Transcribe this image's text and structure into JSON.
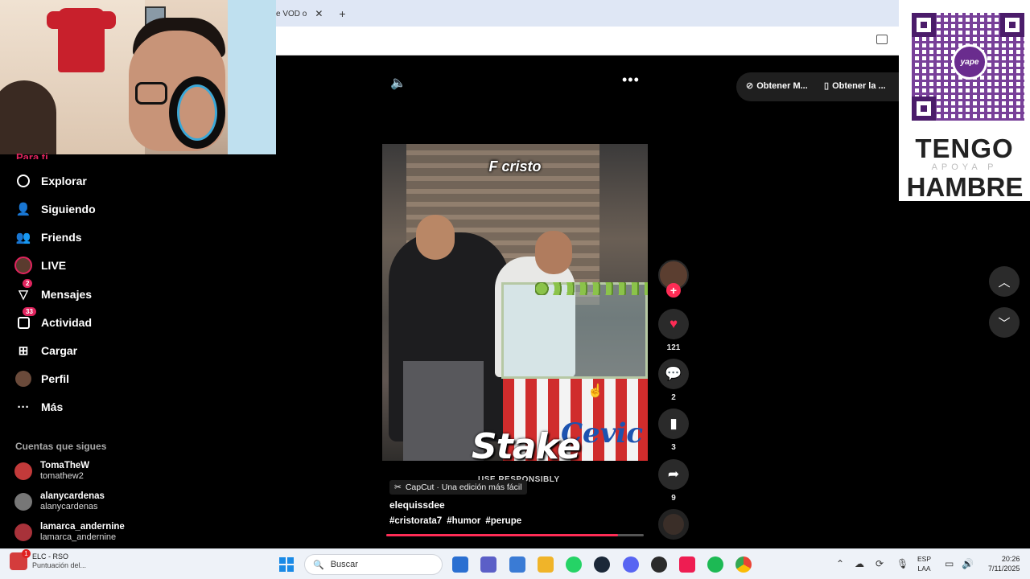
{
  "browser": {
    "tab_fragment": "e VOD o",
    "tab_close": "✕",
    "new_tab": "+"
  },
  "sidebar": {
    "cut_label": "Para ti",
    "items": [
      {
        "label": "Explorar",
        "icon": "compass-icon"
      },
      {
        "label": "Siguiendo",
        "icon": "person-follow-icon"
      },
      {
        "label": "Friends",
        "icon": "friends-icon"
      },
      {
        "label": "LIVE",
        "icon": "live-avatar-icon"
      },
      {
        "label": "Mensajes",
        "icon": "inbox-icon",
        "badge": "2"
      },
      {
        "label": "Actividad",
        "icon": "activity-icon",
        "badge": "33"
      },
      {
        "label": "Cargar",
        "icon": "upload-icon"
      },
      {
        "label": "Perfil",
        "icon": "profile-avatar-icon"
      },
      {
        "label": "Más",
        "icon": "more-dots-icon"
      }
    ],
    "following_title": "Cuentas que sigues",
    "following": [
      {
        "name": "TomaTheW",
        "user": "tomathew2"
      },
      {
        "name": "alanycardenas",
        "user": "alanycardenas"
      },
      {
        "name": "lamarca_andernine",
        "user": "lamarca_andernine"
      }
    ]
  },
  "top_actions": {
    "get_app_1": "Obtener M...",
    "get_app_2": "Obtener la ..."
  },
  "video": {
    "caption": "F cristo",
    "sponsor_logo": "Stake",
    "sponsor_sub": "USE RESPONSIBLY",
    "cart_brand": "Cevic",
    "capcut_label": "CapCut · Una edición más fácil",
    "author": "elequissdee",
    "hashtags": [
      "#cristorata7",
      "#humor",
      "#perupe"
    ],
    "progress": 0.9
  },
  "rail": {
    "likes": "121",
    "comments": "2",
    "saves": "3",
    "shares": "9"
  },
  "overlay": {
    "qr_brand": "yape",
    "line1": "TENGO",
    "line2": "APOYA P",
    "line3": "HAMBRE"
  },
  "taskbar": {
    "app_title": "ELC - RSO",
    "app_sub": "Puntuación del...",
    "app_badge": "1",
    "search_placeholder": "Buscar",
    "lang_1": "ESP",
    "lang_2": "LAA",
    "time": "20:26",
    "date": "7/11/2025"
  },
  "colors": {
    "accent": "#fe2c55",
    "taskbar_bg": "#eef2f8",
    "qr_purple": "#6a2c8e"
  }
}
